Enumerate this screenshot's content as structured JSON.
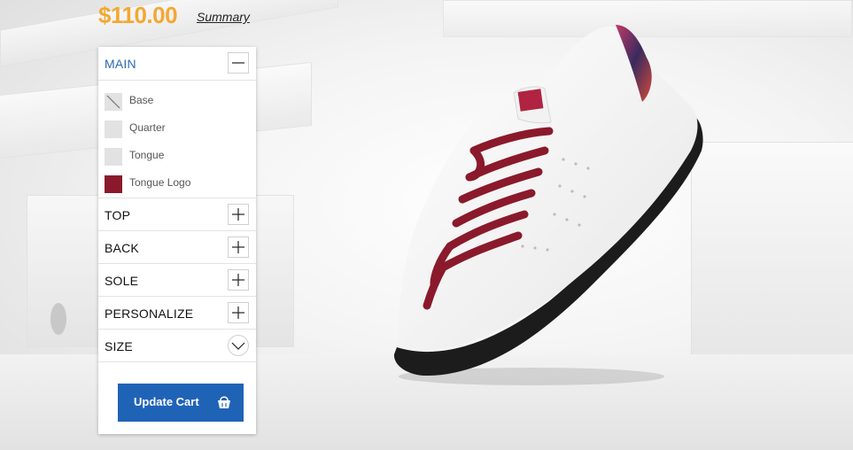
{
  "header": {
    "price": "$110.00",
    "summary_label": "Summary"
  },
  "panel": {
    "main_label": "MAIN",
    "parts": [
      {
        "label": "Base",
        "swatch": "#e2e2e2"
      },
      {
        "label": "Quarter",
        "swatch": "#e2e2e2"
      },
      {
        "label": "Tongue",
        "swatch": "#e2e2e2"
      },
      {
        "label": "Tongue Logo",
        "swatch": "#8a1a2b"
      }
    ],
    "sections": [
      "TOP",
      "BACK",
      "SOLE",
      "PERSONALIZE",
      "SIZE"
    ],
    "cart_label": "Update Cart"
  },
  "colors": {
    "price": "#f3a833",
    "accent": "#2b6bb5",
    "button": "#1f63b7",
    "lace": "#8a1a2b"
  },
  "icons": [
    "minus-icon",
    "plus-icon",
    "chevron-down-icon",
    "shopping-bag-icon",
    "none-swatch-icon"
  ]
}
